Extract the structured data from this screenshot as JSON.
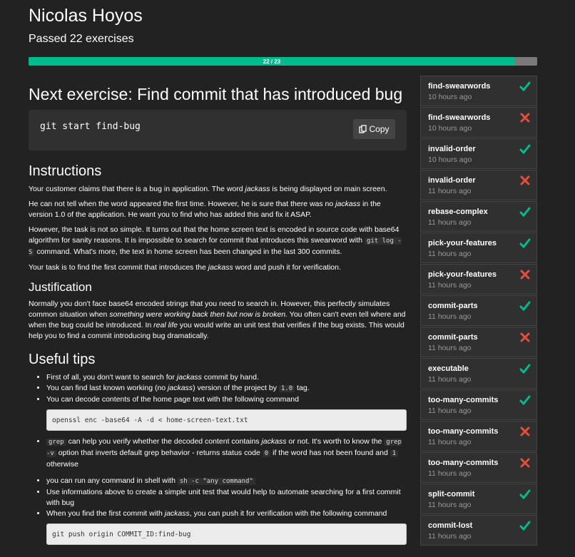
{
  "user": {
    "name": "Nicolas Hoyos",
    "passed_text": "Passed 22 exercises"
  },
  "progress": {
    "label": "22 / 23",
    "done": 22,
    "total": 23
  },
  "next": {
    "title": "Next exercise: Find commit that has introduced bug",
    "command": "git start find-bug",
    "copy_label": "Copy"
  },
  "instructions": {
    "heading": "Instructions",
    "p1_a": "Your customer claims that there is a bug in application. The word ",
    "p1_em": "jackass",
    "p1_b": " is being displayed on main screen.",
    "p2_a": "He can not tell when the word appeared the first time. However, he is sure that there was no ",
    "p2_em": "jackass",
    "p2_b": " in the version 1.0 of the application. He want you to find who has added this and fix it ASAP.",
    "p3_a": "However, the task is not so simple. It turns out that the home screen text is encoded in source code with base64 algorithm for sanity reasons. It is impossible to search for commit that introduces this swearword with ",
    "p3_code": "git log -S",
    "p3_b": " command. What's more, the text in home screen has been changed in the last 300 commits.",
    "p4_a": "Your task is to find the first commit that introduces the ",
    "p4_em": "jackass",
    "p4_b": " word and push it for verification."
  },
  "justification": {
    "heading": "Justification",
    "a": "Normally you don't face base64 encoded strings that you need to search in. However, this perfectly simulates common situation when ",
    "em1": "something were working back then but now is broken.",
    "b": " You often can't even tell where and when the bug could be introduced. In ",
    "em2": "real life",
    "c": " you would write an unit test that verifies if the bug exists. This would help you to find a commit introducing bug dramatically."
  },
  "tips": {
    "heading": "Useful tips",
    "t1_a": "First of all, you don't want to search for ",
    "t1_em": "jackass",
    "t1_b": " commit by hand.",
    "t2_a": "You can find last known working (no ",
    "t2_em": "jackass",
    "t2_b": ") version of the project by ",
    "t2_code": "1.0",
    "t2_c": " tag.",
    "t3": "You can decode contents of the home page text with the following command",
    "pre1": "openssl enc -base64 -A -d < home-screen-text.txt",
    "t4_code1": "grep",
    "t4_a": " can help you verify whether the decoded content contains ",
    "t4_em": "jackass",
    "t4_b": " or not. It's worth to know the ",
    "t4_code2": "grep -v",
    "t4_c": " option that inverts default grep behavior - returns status code ",
    "t4_code3": "0",
    "t4_d": " if the word has not been found and ",
    "t4_code4": "1",
    "t4_e": " otherwise",
    "t5_a": "you can run any command in shell with ",
    "t5_code": "sh -c \"any command\"",
    "t6": "Use informations above to create a simple unit test that would help to automate searching for a first commit with bug",
    "t7_a": "When you find the first commit with ",
    "t7_em": "jackass",
    "t7_b": ", you can push it for verification with the following command",
    "pre2": "git push origin COMMIT_ID:find-bug"
  },
  "history": [
    {
      "name": "find-swearwords",
      "time": "10 hours ago",
      "status": "pass"
    },
    {
      "name": "find-swearwords",
      "time": "10 hours ago",
      "status": "fail"
    },
    {
      "name": "invalid-order",
      "time": "10 hours ago",
      "status": "pass"
    },
    {
      "name": "invalid-order",
      "time": "11 hours ago",
      "status": "fail"
    },
    {
      "name": "rebase-complex",
      "time": "11 hours ago",
      "status": "pass"
    },
    {
      "name": "pick-your-features",
      "time": "11 hours ago",
      "status": "pass"
    },
    {
      "name": "pick-your-features",
      "time": "11 hours ago",
      "status": "fail"
    },
    {
      "name": "commit-parts",
      "time": "11 hours ago",
      "status": "pass"
    },
    {
      "name": "commit-parts",
      "time": "11 hours ago",
      "status": "fail"
    },
    {
      "name": "executable",
      "time": "11 hours ago",
      "status": "pass"
    },
    {
      "name": "too-many-commits",
      "time": "11 hours ago",
      "status": "pass"
    },
    {
      "name": "too-many-commits",
      "time": "11 hours ago",
      "status": "fail"
    },
    {
      "name": "too-many-commits",
      "time": "11 hours ago",
      "status": "fail"
    },
    {
      "name": "split-commit",
      "time": "11 hours ago",
      "status": "pass"
    },
    {
      "name": "commit-lost",
      "time": "11 hours ago",
      "status": "pass"
    }
  ],
  "icons": {
    "pass": "checkmark-icon",
    "fail": "cross-icon",
    "copy": "clipboard-icon"
  },
  "colors": {
    "pass": "#00bc8c",
    "fail": "#e74c3c",
    "accent": "#00bc8c"
  }
}
